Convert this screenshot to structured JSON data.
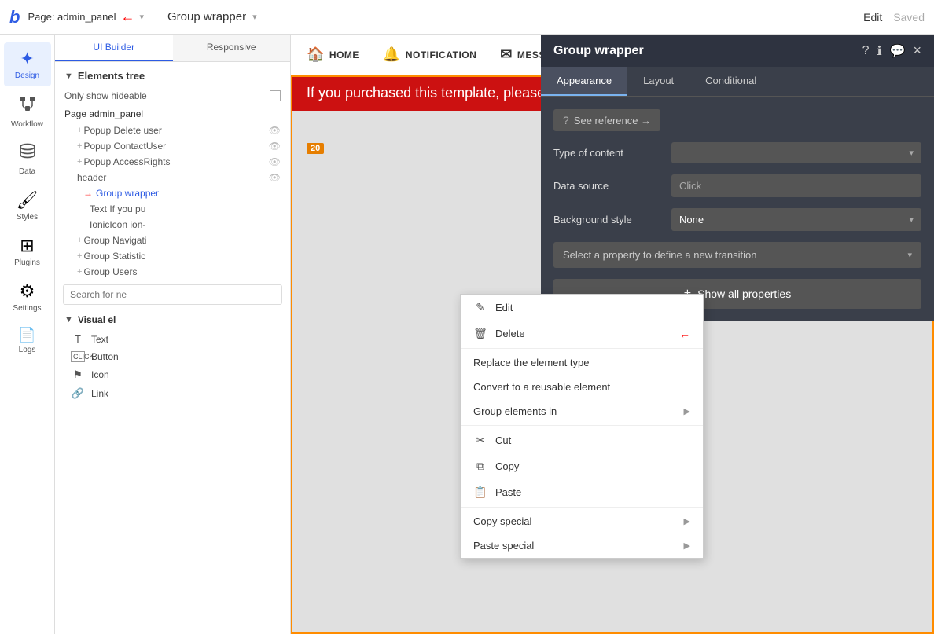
{
  "topbar": {
    "logo": "b",
    "page_title": "Page: admin_panel",
    "dropdown_arrow": "▾",
    "group_wrapper_title": "Group wrapper",
    "edit_label": "Edit",
    "saved_label": "Saved"
  },
  "sidebar": {
    "items": [
      {
        "id": "design",
        "label": "Design",
        "icon": "✦",
        "active": true
      },
      {
        "id": "workflow",
        "label": "Workflow",
        "icon": "⬡"
      },
      {
        "id": "data",
        "label": "Data",
        "icon": "🗄"
      },
      {
        "id": "styles",
        "label": "Styles",
        "icon": "🖌"
      },
      {
        "id": "plugins",
        "label": "Plugins",
        "icon": "⊞"
      },
      {
        "id": "settings",
        "label": "Settings",
        "icon": "⚙"
      },
      {
        "id": "logs",
        "label": "Logs",
        "icon": "📄"
      }
    ]
  },
  "panel": {
    "tab_ui_builder": "UI Builder",
    "tab_responsive": "Responsive",
    "elements_tree_label": "Elements tree",
    "show_hideable_label": "Only show hideable",
    "page_label": "Page admin_panel",
    "tree_items": [
      {
        "text": "+Popup Delete user",
        "indent": 1,
        "eye": true
      },
      {
        "text": "+Popup ContactUser",
        "indent": 1,
        "eye": true
      },
      {
        "text": "+Popup AccessRights",
        "indent": 1,
        "eye": true
      },
      {
        "text": "header",
        "indent": 1,
        "eye": true
      },
      {
        "text": "Group wrapper",
        "indent": 2,
        "active": true
      },
      {
        "text": "Text If you pu",
        "indent": 3
      },
      {
        "text": "IonicIcon ion-",
        "indent": 3
      },
      {
        "text": "+Group Navigati",
        "indent": 1
      },
      {
        "text": "+Group Statistic",
        "indent": 1
      },
      {
        "text": "+Group Users",
        "indent": 1
      }
    ],
    "search_placeholder": "Search for ne",
    "visual_elements_label": "Visual el",
    "ve_items": [
      {
        "icon": "T",
        "label": "Text"
      },
      {
        "icon": "☐",
        "label": "Button",
        "prefix": "CLICK"
      },
      {
        "icon": "⚑",
        "label": "Icon"
      },
      {
        "icon": "🔗",
        "label": "Link"
      }
    ]
  },
  "canvas": {
    "nav_items": [
      {
        "icon": "🏠",
        "label": "HOME"
      },
      {
        "icon": "🔔",
        "label": "NOTIFICATION"
      },
      {
        "icon": "✉",
        "label": "MESSAGES"
      }
    ],
    "banner_text": "If you purchased this template, please c",
    "number_badge": "20"
  },
  "context_menu": {
    "items": [
      {
        "id": "edit",
        "icon": "✎",
        "label": "Edit"
      },
      {
        "id": "delete",
        "icon": "🗑",
        "label": "Delete",
        "has_arrow": true
      },
      {
        "id": "replace",
        "label": "Replace the element type"
      },
      {
        "id": "convert",
        "label": "Convert to a reusable element"
      },
      {
        "id": "group",
        "label": "Group elements in",
        "has_submenu": true
      },
      {
        "id": "cut",
        "icon": "✂",
        "label": "Cut"
      },
      {
        "id": "copy",
        "icon": "⧉",
        "label": "Copy"
      },
      {
        "id": "paste",
        "icon": "📋",
        "label": "Paste"
      },
      {
        "id": "copy_special",
        "label": "Copy special",
        "has_submenu": true
      },
      {
        "id": "paste_special",
        "label": "Paste special",
        "has_submenu": true
      }
    ]
  },
  "gw_panel": {
    "title": "Group wrapper",
    "icons": {
      "question": "?",
      "info": "ℹ",
      "comment": "💬",
      "close": "×"
    },
    "tabs": [
      {
        "id": "appearance",
        "label": "Appearance",
        "active": true
      },
      {
        "id": "layout",
        "label": "Layout"
      },
      {
        "id": "conditional",
        "label": "Conditional"
      }
    ],
    "see_reference_label": "See reference →",
    "type_of_content_label": "Type of content",
    "type_of_content_placeholder": "",
    "data_source_label": "Data source",
    "data_source_placeholder": "Click",
    "background_style_label": "Background style",
    "background_style_value": "None",
    "transition_placeholder": "Select a property to define a new transition",
    "show_all_label": "Show all properties"
  }
}
